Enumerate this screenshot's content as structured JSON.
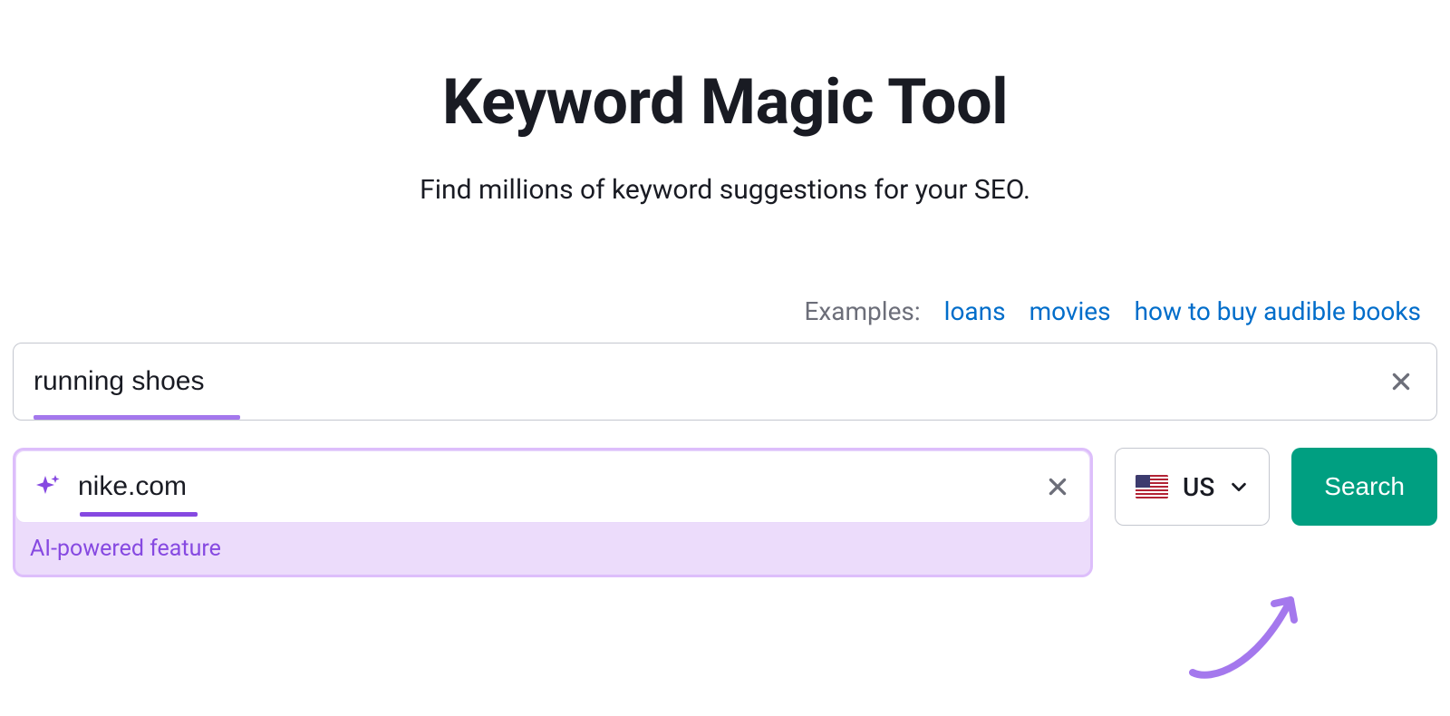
{
  "header": {
    "title": "Keyword Magic Tool",
    "subtitle": "Find millions of keyword suggestions for your SEO."
  },
  "examples": {
    "label": "Examples:",
    "links": [
      "loans",
      "movies",
      "how to buy audible books"
    ]
  },
  "keyword_input": {
    "value": "running shoes"
  },
  "domain_input": {
    "value": "nike.com",
    "ai_label": "AI-powered feature"
  },
  "country": {
    "label": "US"
  },
  "search_button": {
    "label": "Search"
  }
}
